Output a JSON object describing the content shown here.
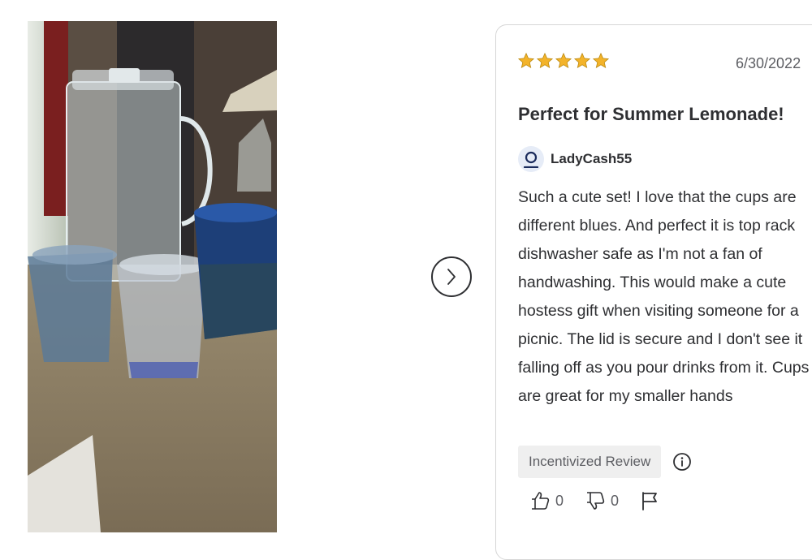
{
  "review": {
    "rating": 5,
    "max_rating": 5,
    "date": "6/30/2022",
    "title": "Perfect for Summer Lemonade!",
    "author": "LadyCash55",
    "body": "Such a cute set! I love that the cups are different blues. And perfect it is top rack dishwasher safe as I'm not a fan of handwashing. This would make a cute hostess gift when visiting someone for a picnic. The lid is secure and I don't see it falling off as you pour drinks from it. Cups are great for my smaller hands",
    "badge": "Incentivized Review",
    "helpful_count": "0",
    "unhelpful_count": "0"
  },
  "icons": {
    "star": "star-icon",
    "next": "chevron-right-icon",
    "avatar": "user-icon",
    "info": "info-icon",
    "thumbs_up": "thumbs-up-icon",
    "thumbs_down": "thumbs-down-icon",
    "flag": "flag-icon"
  },
  "colors": {
    "star": "#f3b32a",
    "text": "#2e2f32",
    "muted": "#5d5e63",
    "badge_bg": "#efefef",
    "avatar_bg": "#e6ecf7",
    "avatar_icon": "#1a2b5c"
  }
}
